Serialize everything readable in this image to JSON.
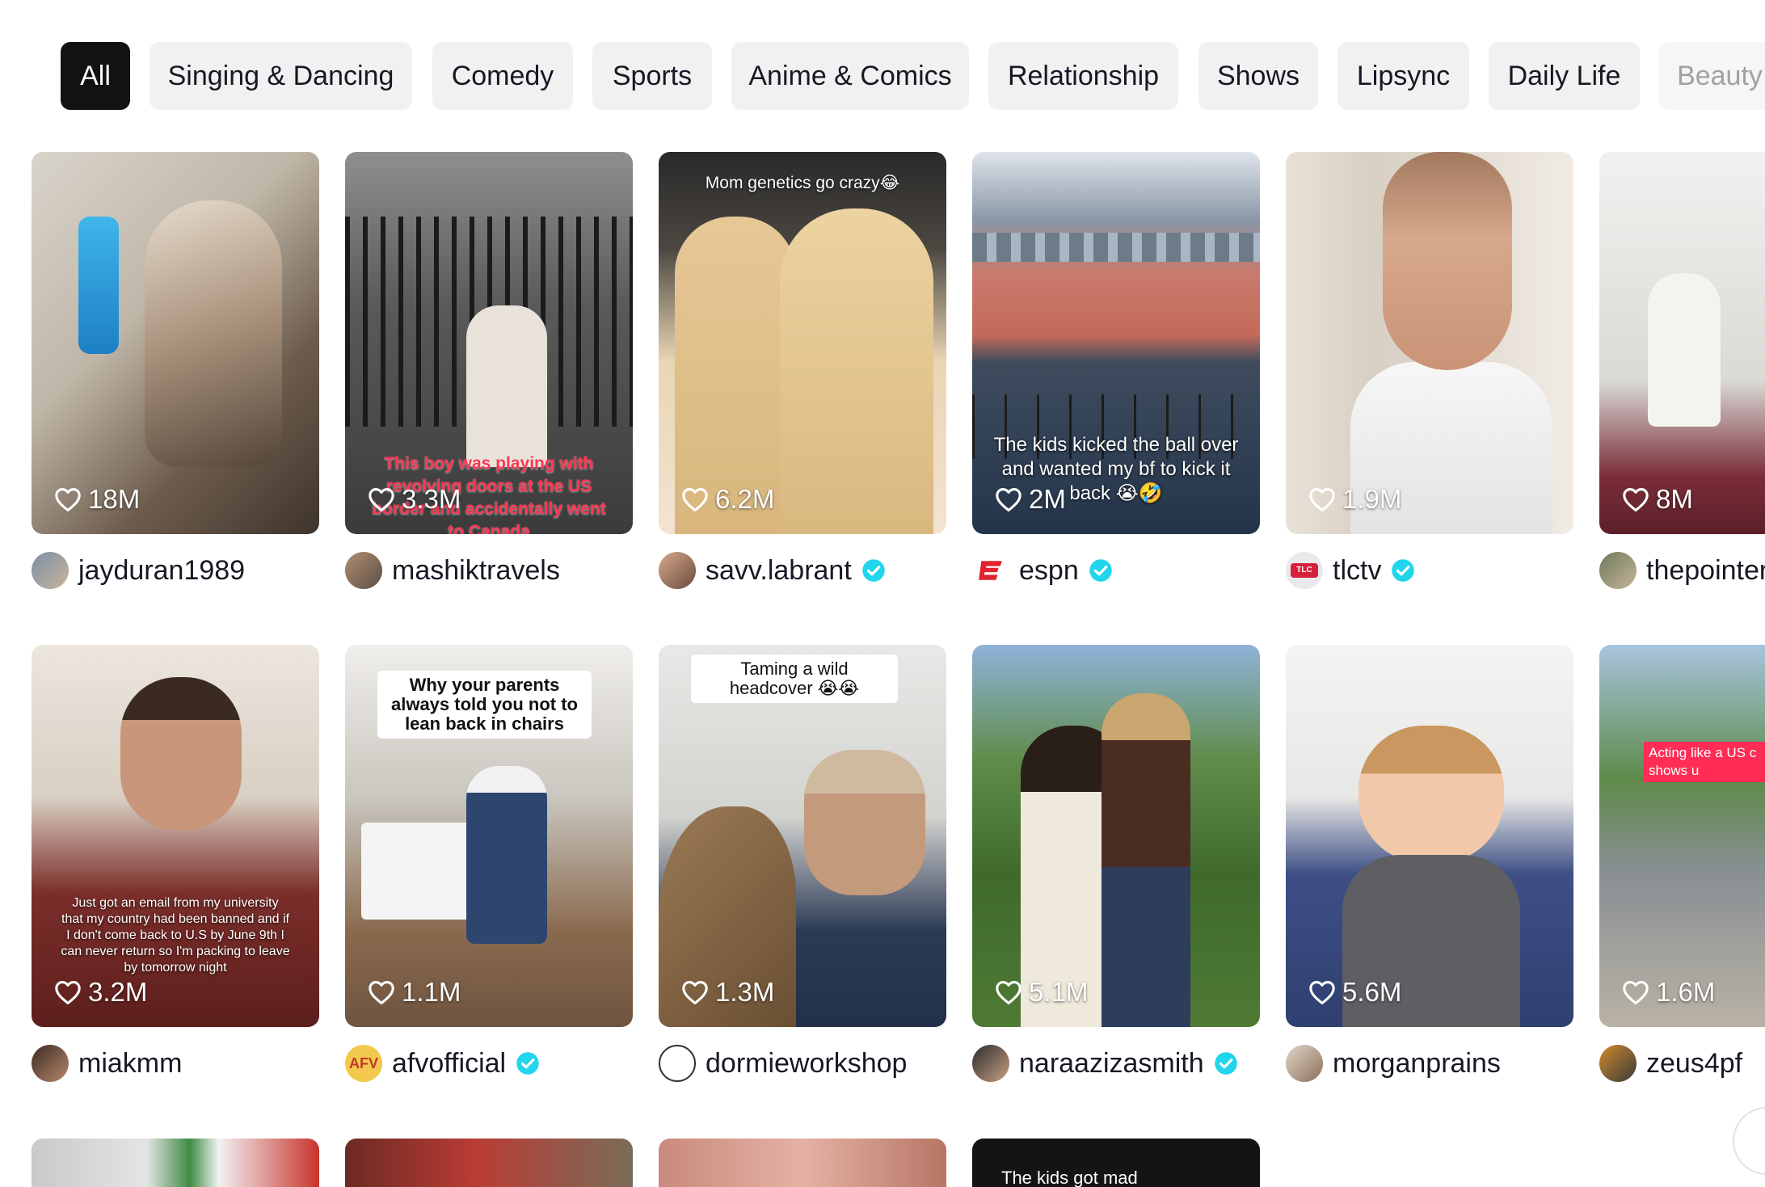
{
  "categories": [
    "All",
    "Singing & Dancing",
    "Comedy",
    "Sports",
    "Anime & Comics",
    "Relationship",
    "Shows",
    "Lipsync",
    "Daily Life",
    "Beauty"
  ],
  "active_category": "All",
  "videos": [
    {
      "likes": "18M",
      "author": "jayduran1989",
      "verified": false,
      "caption": ""
    },
    {
      "likes": "3.3M",
      "author": "mashiktravels",
      "verified": false,
      "caption": "This boy was playing with revolving doors at the US border and accidentally went to Canada"
    },
    {
      "likes": "6.2M",
      "author": "savv.labrant",
      "verified": true,
      "caption": "Mom genetics go crazy😂"
    },
    {
      "likes": "2M",
      "author": "espn",
      "verified": true,
      "caption": "The kids kicked the ball over and wanted my bf to kick it back 😭🤣"
    },
    {
      "likes": "1.9M",
      "author": "tlctv",
      "verified": true,
      "caption": ""
    },
    {
      "likes": "8M",
      "author": "thepointer",
      "verified": false,
      "caption": ""
    },
    {
      "likes": "3.2M",
      "author": "miakmm",
      "verified": false,
      "caption": "Just got an email from my university that my country had been banned and if I don't come back to U.S by June 9th I can never return so I'm packing to leave by tomorrow night"
    },
    {
      "likes": "1.1M",
      "author": "afvofficial",
      "verified": true,
      "caption": "Why your parents always told you not to lean back in chairs"
    },
    {
      "likes": "1.3M",
      "author": "dormieworkshop",
      "verified": false,
      "caption": "Taming a wild headcover 😭😭"
    },
    {
      "likes": "5.1M",
      "author": "naraazizasmith",
      "verified": true,
      "caption": ""
    },
    {
      "likes": "5.6M",
      "author": "morganprains",
      "verified": false,
      "caption": ""
    },
    {
      "likes": "1.6M",
      "author": "zeus4pf",
      "verified": false,
      "caption": "Acting like a US c shows u"
    }
  ],
  "partial_row_caption": "The kids got mad",
  "colors": {
    "active_chip_bg": "#121212",
    "chip_bg": "#f1f1f2",
    "verified_badge": "#20d5ec",
    "text": "#161823"
  },
  "icons": {
    "likes": "heart-outline-icon",
    "verified": "verified-check-icon"
  }
}
